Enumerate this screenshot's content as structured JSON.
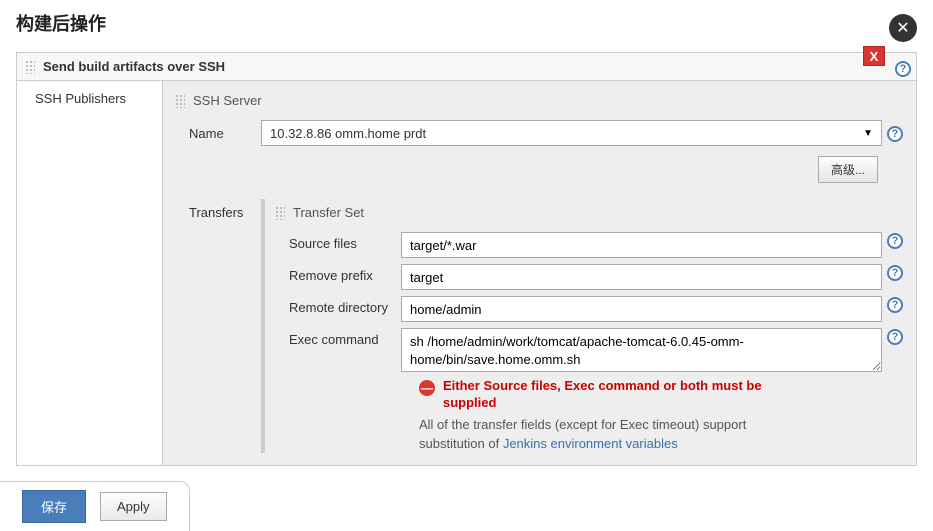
{
  "page": {
    "title": "构建后操作"
  },
  "section": {
    "title": "Send build artifacts over SSH",
    "close_x": "X"
  },
  "publishers": {
    "label": "SSH Publishers"
  },
  "server": {
    "header": "SSH Server",
    "name_label": "Name",
    "name_value": "10.32.8.86 omm.home prdt",
    "advanced": "高级..."
  },
  "transfers": {
    "label": "Transfers",
    "set_header": "Transfer Set",
    "fields": {
      "source_files_label": "Source files",
      "source_files_value": "target/*.war",
      "remove_prefix_label": "Remove prefix",
      "remove_prefix_value": "target",
      "remote_dir_label": "Remote directory",
      "remote_dir_value": "home/admin",
      "exec_command_label": "Exec command",
      "exec_command_value": "sh /home/admin/work/tomcat/apache-tomcat-6.0.45-omm-home/bin/save.home.omm.sh"
    },
    "validation_error": "Either Source files, Exec command or both must be supplied",
    "hint_prefix": "All of the transfer fields (except for Exec timeout) support substitution of ",
    "hint_link": "Jenkins environment variables"
  },
  "footer": {
    "save": "保存",
    "apply": "Apply"
  }
}
